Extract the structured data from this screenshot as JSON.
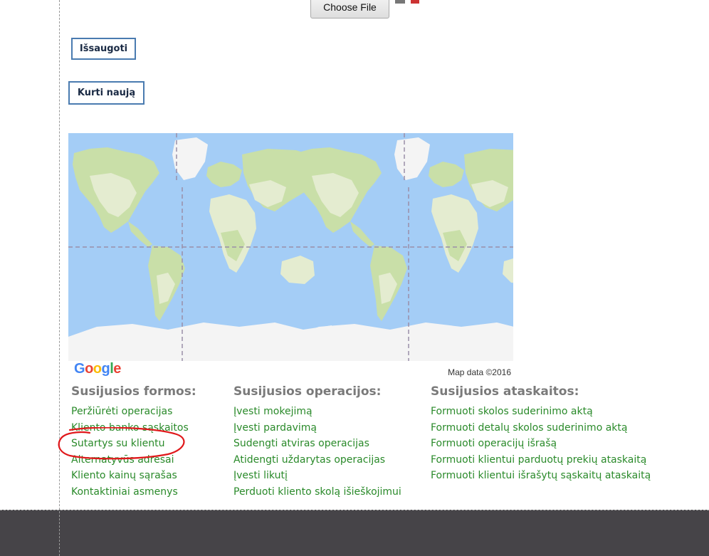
{
  "upload": {
    "choose_file_label": "Choose File"
  },
  "actions": {
    "save_label": "Išsaugoti",
    "new_label": "Kurti naują"
  },
  "map": {
    "logo_letters": [
      "G",
      "o",
      "o",
      "g",
      "l",
      "e"
    ],
    "attribution": "Map data ©2016"
  },
  "related_forms": {
    "heading": "Susijusios formos:",
    "items": [
      "Peržiūrėti operacijas",
      "Kliento banko sąskaitos",
      "Sutartys su klientu",
      "Alternatyvūs adresai",
      "Kliento kainų sąrašas",
      "Kontaktiniai asmenys"
    ]
  },
  "related_operations": {
    "heading": "Susijusios operacijos:",
    "items": [
      "Įvesti mokejimą",
      "Įvesti pardavimą",
      "Sudengti atviras operacijas",
      "Atidengti uždarytas operacijas",
      "Įvesti likutį",
      "Perduoti kliento skolą išieškojimui"
    ]
  },
  "related_reports": {
    "heading": "Susijusios ataskaitos:",
    "items": [
      "Formuoti skolos suderinimo aktą",
      "Formuoti detalų skolos suderinimo aktą",
      "Formuoti operacijų išrašą",
      "Formuoti klientui parduotų prekių ataskaitą",
      "Formuoti klientui išrašytų sąskaitų ataskaitą"
    ]
  },
  "colors": {
    "link_green": "#2a8a2a",
    "heading_gray": "#7a7a7a",
    "button_border": "#4a7bb0",
    "ocean": "#a4cdf6",
    "land": "#e4ecd0",
    "forest": "#c9dfa8",
    "ice": "#f4f4f4",
    "annotation_red": "#e0181b",
    "footer": "#464448"
  }
}
